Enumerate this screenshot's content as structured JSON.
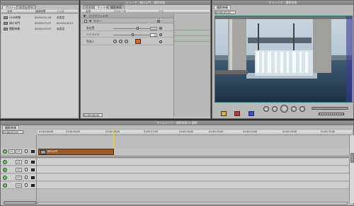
{
  "browser": {
    "title": "",
    "tabs": [
      "プロジェクト",
      "エフェクト"
    ],
    "columns": [
      "名前",
      "継続時間",
      "イン点"
    ],
    "items": [
      {
        "name": "HDR映像",
        "duration": "00:00:01;28",
        "in": "未設定"
      },
      {
        "name": "緑口水門",
        "duration": "00:00:07;07",
        "in": "00:00:04;17"
      },
      {
        "name": "撮影映像",
        "duration": "00:00:07;07",
        "in": "未設定"
      }
    ]
  },
  "viewer": {
    "title": "ビューア : 緑口水門 : 撮影映像",
    "tabs": [
      "ビデオ",
      "フィルタ",
      "撮影映像"
    ],
    "columns": [
      "名前",
      "パラメータ",
      "ナビ"
    ],
    "section_label": "ビデオフィルタ",
    "subsection_label": "カラー",
    "params": [
      {
        "label": "彩位置",
        "value": "100"
      },
      {
        "label": "ハイライト",
        "value": "0"
      },
      {
        "label": "色合い",
        "value": ""
      }
    ],
    "timecode_bottom": "01:00:00;00",
    "accent_color": "#d96a2b"
  },
  "canvas": {
    "title": "キャンバス : 撮影映像",
    "tab": "撮影映像",
    "timecode": "00:00:07;07",
    "buttons": [
      "play-in-out",
      "prev-edit",
      "play",
      "next-edit",
      "match-frame"
    ]
  },
  "timeline": {
    "title": "タイムライン : 撮影映像 in 撮影",
    "tab": "撮影映像",
    "timecode": "01:00:07;07",
    "ruler": [
      "01:00:00;00",
      "01:00:04;00",
      "01:00:08;00",
      "01:00:12;00",
      "01:00:16;00",
      "01:00:20;00",
      "01:00:24;00",
      "01:00:28;00",
      "01:00:32;00"
    ],
    "tracks": [
      {
        "id": "V1",
        "src": "v1",
        "clip": "緑口水門"
      },
      {
        "id": "A1",
        "src": "a1",
        "clip": ""
      },
      {
        "id": "A2",
        "src": "a2",
        "clip": ""
      },
      {
        "id": "A3",
        "src": "a3",
        "clip": ""
      },
      {
        "id": "A4",
        "src": "a4",
        "clip": ""
      }
    ],
    "clip_color": "#9a5a28"
  }
}
